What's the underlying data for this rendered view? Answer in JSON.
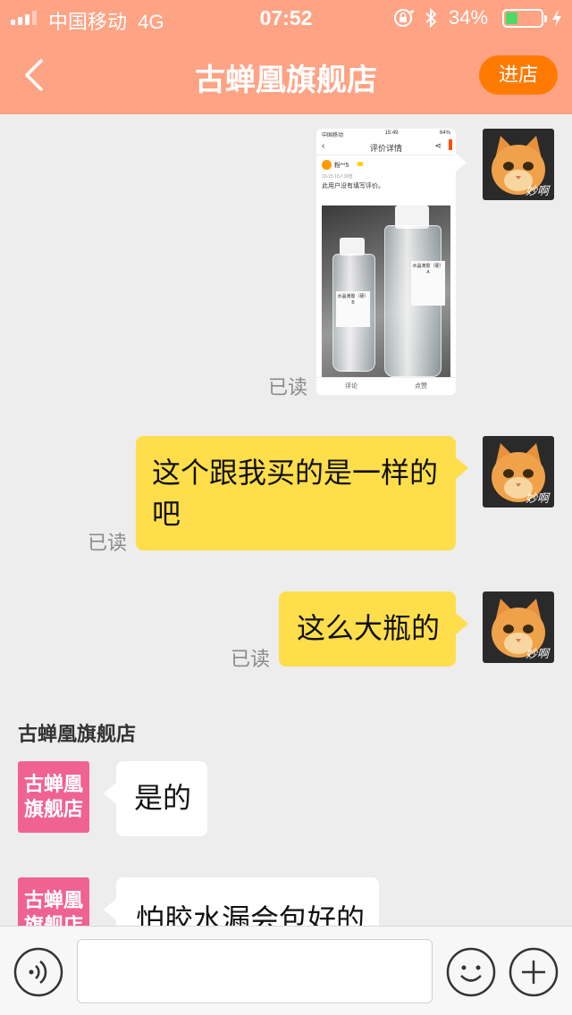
{
  "status_bar": {
    "carrier": "中国移动",
    "network": "4G",
    "time": "07:52",
    "battery_percent": "34%",
    "battery_level": 0.34,
    "icons": [
      "signal-icon",
      "orientation-lock-icon",
      "bluetooth-icon",
      "battery-icon",
      "charging-icon"
    ]
  },
  "nav": {
    "title": "古蝉凰旗舰店",
    "enter_label": "进店",
    "back_icon": "chevron-left-icon"
  },
  "colors": {
    "header": "#ffa385",
    "enter_button": "#ff7a00",
    "my_bubble": "#ffde4b",
    "shop_avatar": "#f06292",
    "background": "#ededed"
  },
  "my_avatar_caption": "妙啊",
  "shop_avatar_text": "古蝉凰旗舰店",
  "shop_avatar_lines": [
    "古蝉凰",
    "旗舰店"
  ],
  "messages": {
    "image": {
      "read": "已读",
      "screenshot": {
        "status_carrier": "中国移动",
        "status_time": "15:49",
        "status_battery": "64%",
        "title": "评价详情",
        "user": "粉**5",
        "meta": "10-15  16人浏览",
        "text": "此用户没有填写评价。",
        "bottle_b": "水晶滴胶（硬）B",
        "bottle_a": "水晶滴胶（硬）A",
        "comment": "评论",
        "like": "点赞"
      }
    },
    "text1": {
      "line1": "这个跟我买的是一样的",
      "line2": "吧",
      "read": "已读"
    },
    "text2": {
      "text": "这么大瓶的",
      "read": "已读"
    },
    "shop_name": "古蝉凰旗舰店",
    "reply1": {
      "text": "是的"
    },
    "reply2": {
      "text": "怕胶水漏会包好的"
    }
  },
  "input": {
    "placeholder": "",
    "value": "",
    "icons": [
      "voice-icon",
      "emoji-icon",
      "plus-icon"
    ]
  }
}
